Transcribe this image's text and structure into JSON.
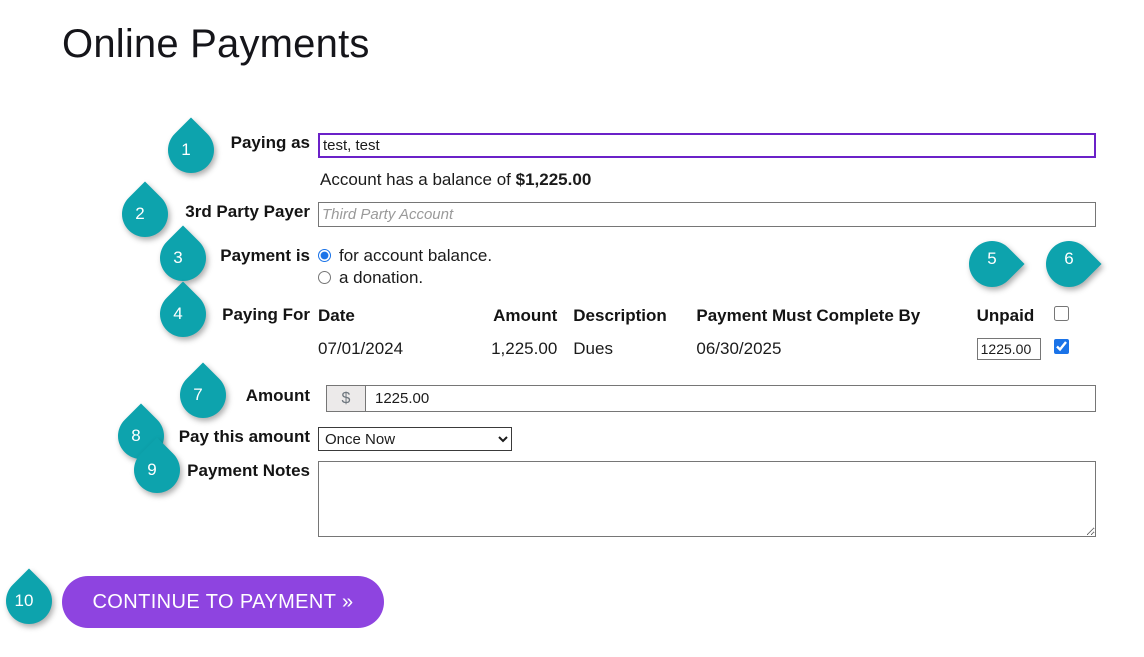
{
  "page": {
    "title": "Online Payments"
  },
  "form": {
    "paying_as": {
      "label": "Paying as",
      "value": "test, test",
      "placeholder": ""
    },
    "balance": {
      "prefix": "Account has a balance of ",
      "amount": "$1,225.00"
    },
    "third_party": {
      "label": "3rd Party Payer",
      "value": "",
      "placeholder": "Third Party Account"
    },
    "payment_is": {
      "label": "Payment is",
      "options": [
        {
          "label": "for account balance.",
          "selected": true
        },
        {
          "label": "a donation.",
          "selected": false
        }
      ]
    },
    "paying_for": {
      "label": "Paying For",
      "columns": [
        "Date",
        "Amount",
        "Description",
        "Payment Must Complete By",
        "Unpaid",
        ""
      ],
      "header_checkbox_checked": false,
      "rows": [
        {
          "date": "07/01/2024",
          "amount": "1,225.00",
          "description": "Dues",
          "due": "06/30/2025",
          "unpaid": "1225.00",
          "checked": true
        }
      ]
    },
    "amount": {
      "label": "Amount",
      "currency_symbol": "$",
      "value": "1225.00"
    },
    "pay_this_amount": {
      "label": "Pay this amount",
      "selected": "Once Now",
      "options": [
        "Once Now"
      ]
    },
    "payment_notes": {
      "label": "Payment Notes",
      "value": "",
      "placeholder": ""
    }
  },
  "actions": {
    "continue": "CONTINUE TO PAYMENT »"
  },
  "callouts": [
    {
      "number": "1",
      "direction": "right"
    },
    {
      "number": "2",
      "direction": "right"
    },
    {
      "number": "3",
      "direction": "right"
    },
    {
      "number": "4",
      "direction": "right"
    },
    {
      "number": "5",
      "direction": "down"
    },
    {
      "number": "6",
      "direction": "down"
    },
    {
      "number": "7",
      "direction": "right"
    },
    {
      "number": "8",
      "direction": "right"
    },
    {
      "number": "9",
      "direction": "right"
    },
    {
      "number": "10",
      "direction": "right"
    }
  ],
  "colors": {
    "callout_teal": "#0da3ad",
    "button_purple": "#8e44e0",
    "focus_border": "#6b21c8",
    "checkbox_blue": "#1a73e8"
  }
}
